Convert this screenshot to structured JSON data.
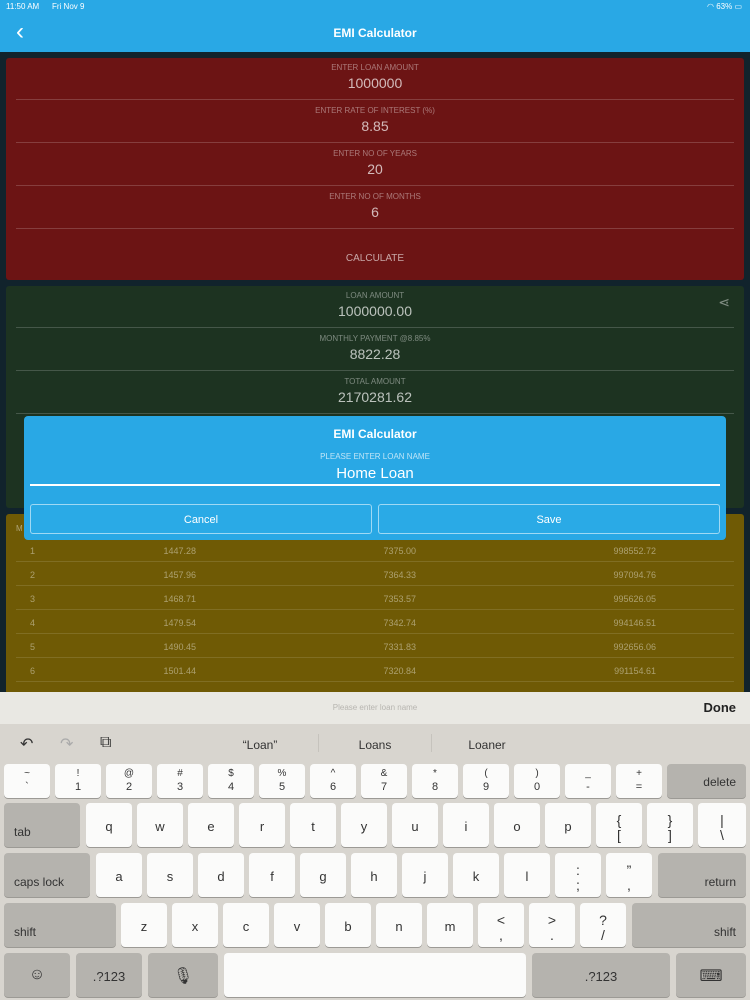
{
  "status_bar": {
    "time": "11:50 AM",
    "date": "Fri Nov 9",
    "battery": "63%"
  },
  "nav": {
    "title": "EMI Calculator",
    "back_icon": "chevron-left-icon"
  },
  "input_card": {
    "color": "#6c1414",
    "fields": [
      {
        "label": "ENTER LOAN AMOUNT",
        "value": "1000000"
      },
      {
        "label": "ENTER RATE OF INTEREST (%)",
        "value": "8.85"
      },
      {
        "label": "ENTER NO OF YEARS",
        "value": "20"
      },
      {
        "label": "ENTER NO OF MONTHS",
        "value": "6"
      }
    ],
    "calculate_label": "CALCULATE"
  },
  "result_card": {
    "color": "#1d3321",
    "share_icon": "share-icon",
    "fields": [
      {
        "label": "LOAN AMOUNT",
        "value": "1000000.00"
      },
      {
        "label": "MONTHLY PAYMENT @8.85%",
        "value": "8822.28"
      },
      {
        "label": "TOTAL AMOUNT",
        "value": "2170281.62"
      }
    ]
  },
  "schedule": {
    "color": "#6f5a05",
    "header_first_char": "M",
    "rows": [
      {
        "month": "1",
        "principal": "1447.28",
        "interest": "7375.00",
        "balance": "998552.72"
      },
      {
        "month": "2",
        "principal": "1457.96",
        "interest": "7364.33",
        "balance": "997094.76"
      },
      {
        "month": "3",
        "principal": "1468.71",
        "interest": "7353.57",
        "balance": "995626.05"
      },
      {
        "month": "4",
        "principal": "1479.54",
        "interest": "7342.74",
        "balance": "994146.51"
      },
      {
        "month": "5",
        "principal": "1490.45",
        "interest": "7331.83",
        "balance": "992656.06"
      },
      {
        "month": "6",
        "principal": "1501.44",
        "interest": "7320.84",
        "balance": "991154.61"
      }
    ]
  },
  "dialog": {
    "title": "EMI Calculator",
    "prompt": "PLEASE ENTER LOAN NAME",
    "input_value": "Home Loan",
    "cancel_label": "Cancel",
    "save_label": "Save"
  },
  "accessory_bar": {
    "placeholder": "Please enter loan name",
    "done_label": "Done"
  },
  "keyboard": {
    "suggestions": [
      "“Loan”",
      "Loans",
      "Loaner"
    ],
    "number_row": [
      {
        "top": "~",
        "bottom": "`"
      },
      {
        "top": "!",
        "bottom": "1"
      },
      {
        "top": "@",
        "bottom": "2"
      },
      {
        "top": "#",
        "bottom": "3"
      },
      {
        "top": "$",
        "bottom": "4"
      },
      {
        "top": "%",
        "bottom": "5"
      },
      {
        "top": "^",
        "bottom": "6"
      },
      {
        "top": "&",
        "bottom": "7"
      },
      {
        "top": "*",
        "bottom": "8"
      },
      {
        "top": "(",
        "bottom": "9"
      },
      {
        "top": ")",
        "bottom": "0"
      },
      {
        "top": "_",
        "bottom": "-"
      },
      {
        "top": "+",
        "bottom": "="
      }
    ],
    "delete_label": "delete",
    "tab_label": "tab",
    "row2": [
      "q",
      "w",
      "e",
      "r",
      "t",
      "y",
      "u",
      "i",
      "o",
      "p"
    ],
    "row2_punct": [
      {
        "top": "{",
        "bottom": "["
      },
      {
        "top": "}",
        "bottom": "]"
      },
      {
        "top": "|",
        "bottom": "\\"
      }
    ],
    "caps_label": "caps lock",
    "row3": [
      "a",
      "s",
      "d",
      "f",
      "g",
      "h",
      "j",
      "k",
      "l"
    ],
    "row3_punct": [
      {
        "top": ":",
        "bottom": ";"
      },
      {
        "top": "”",
        "bottom": ","
      }
    ],
    "return_label": "return",
    "shift_label": "shift",
    "row4": [
      "z",
      "x",
      "c",
      "v",
      "b",
      "n",
      "m"
    ],
    "row4_punct": [
      {
        "top": "<",
        "bottom": ","
      },
      {
        "top": ">",
        "bottom": "."
      },
      {
        "top": "?",
        "bottom": "/"
      }
    ],
    "mode_label": ".?123",
    "emoji_icon": "emoji-icon",
    "mic_icon": "microphone-icon",
    "hide_icon": "keyboard-hide-icon"
  }
}
